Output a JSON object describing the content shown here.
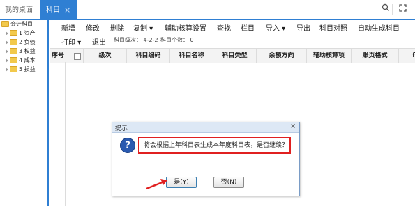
{
  "tabs": {
    "home": "我的桌面",
    "active": "科目",
    "close_glyph": "×"
  },
  "topbar_icons": [
    "search-icon",
    "fullscreen-icon"
  ],
  "tree": {
    "root": "会计科目",
    "items": [
      "1 资产",
      "2 负债",
      "3 权益",
      "4 成本",
      "5 损益"
    ]
  },
  "toolbar": {
    "items": [
      "新增",
      "修改",
      "删除",
      "复制 ▾",
      "辅助核算设置",
      "查找",
      "栏目",
      "导入 ▾",
      "导出",
      "科目对照",
      "自动生成科目"
    ]
  },
  "toolbar2": {
    "print": "打印 ▾",
    "exit": "退出",
    "level_info": "科目级次： 4-2-2",
    "count_info": "科目个数： 0"
  },
  "grid": {
    "columns": [
      "序号",
      "",
      "级次",
      "科目编码",
      "科目名称",
      "科目类型",
      "余额方向",
      "辅助核算项",
      "账页格式",
      "f"
    ]
  },
  "dialog": {
    "title": "提示",
    "close_glyph": "×",
    "message": "将会根据上年科目表生成本年度科目表，是否继续？",
    "yes": "是(Y)",
    "no": "否(N)"
  },
  "colors": {
    "accent": "#2f7fd3",
    "highlight_border": "#e02020",
    "arrow": "#e02020"
  }
}
